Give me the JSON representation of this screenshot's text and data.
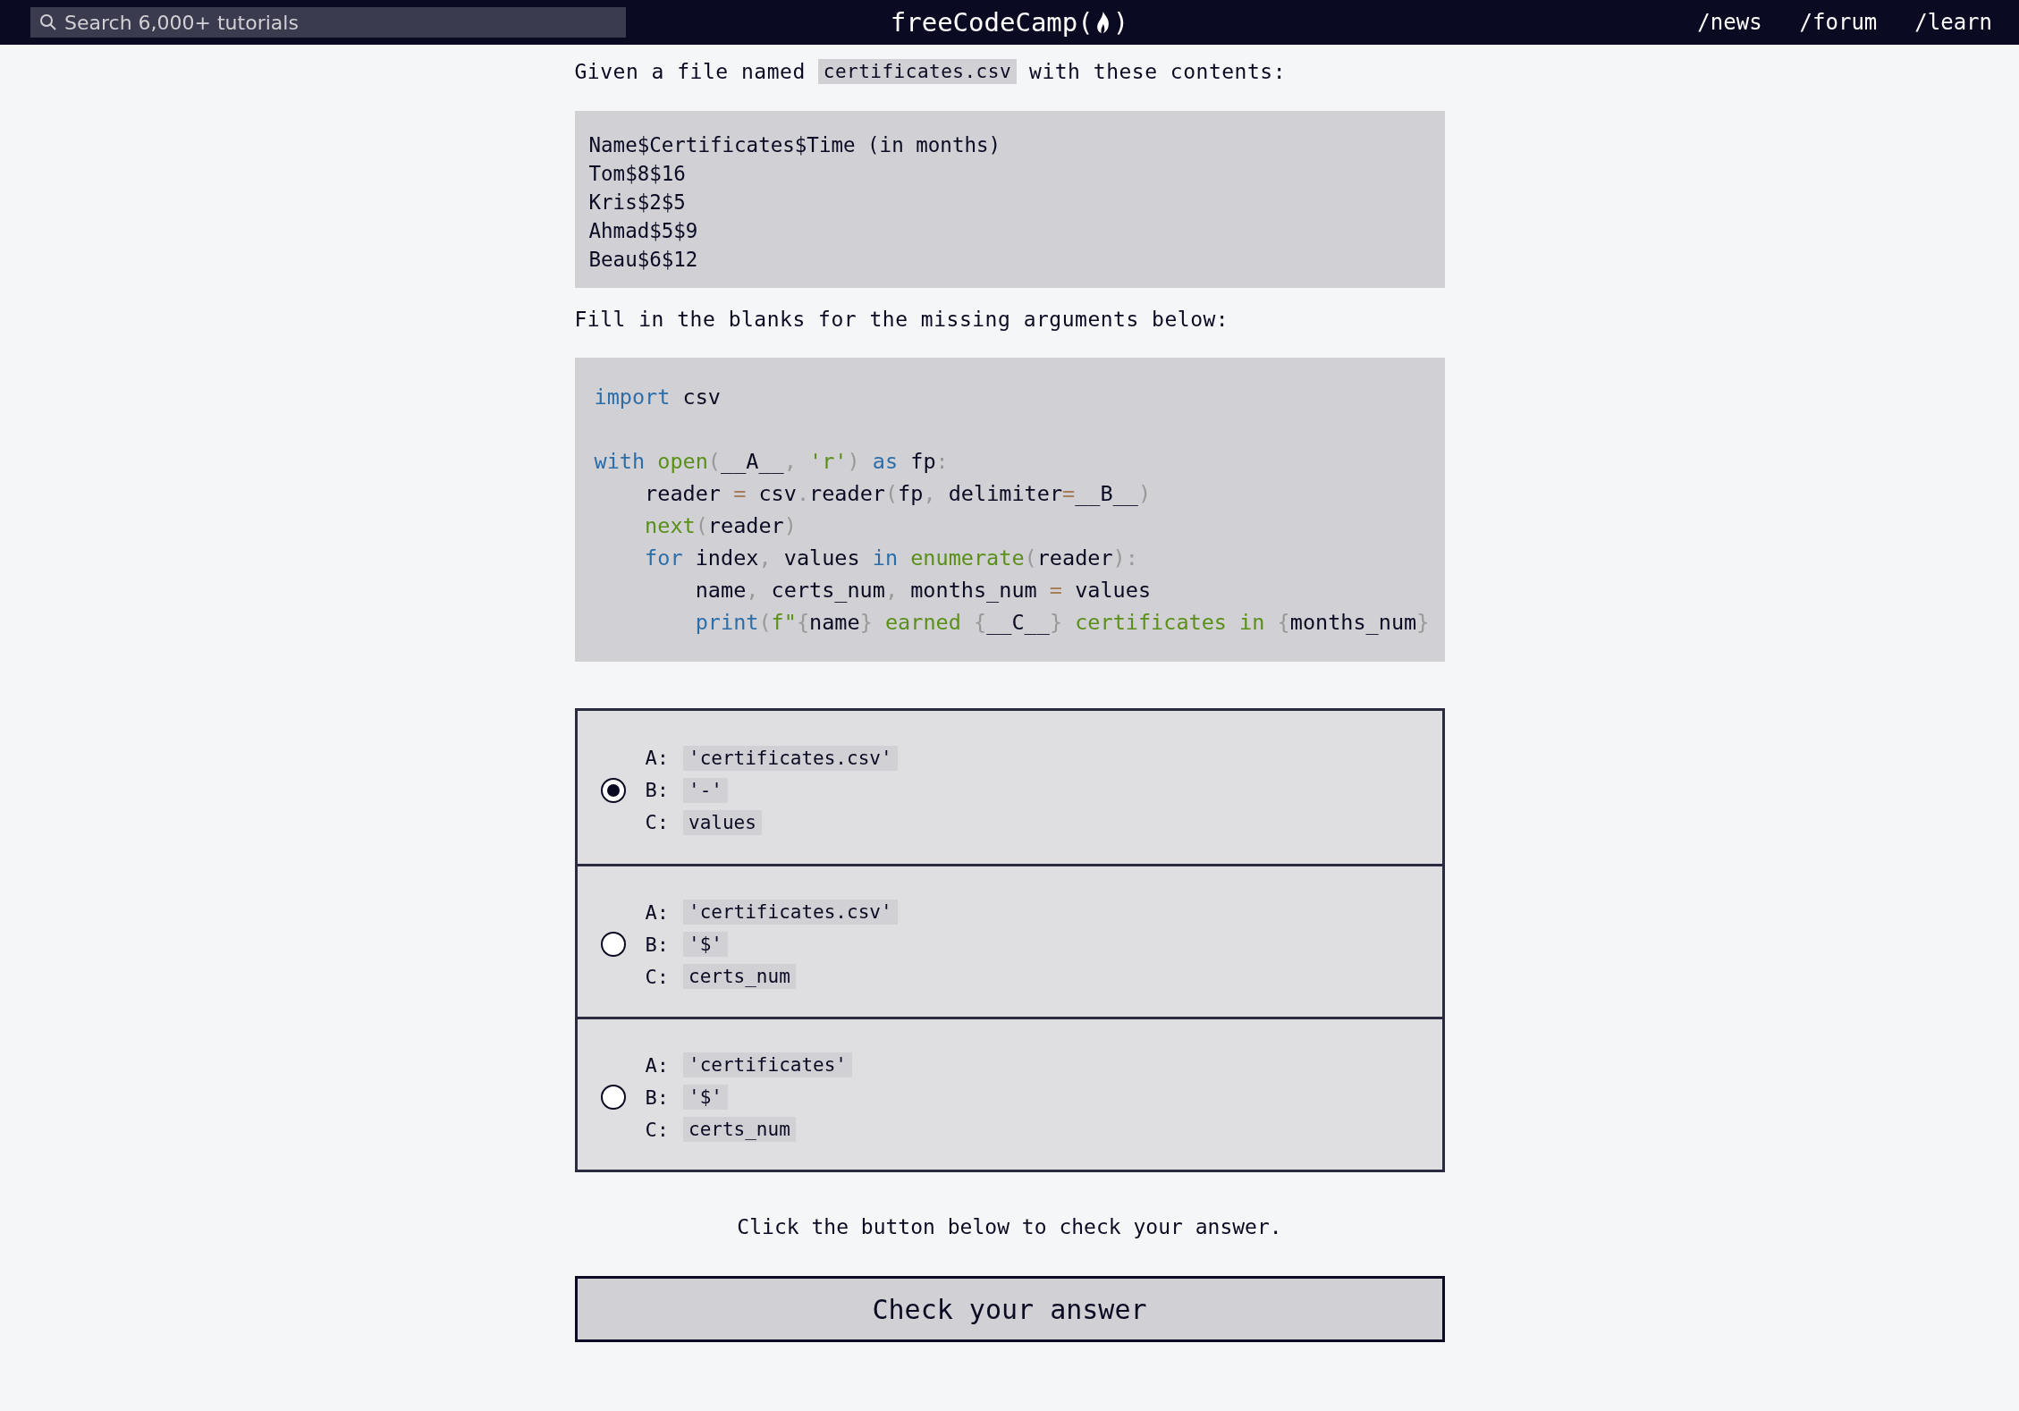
{
  "header": {
    "search": {
      "placeholder": "Search 6,000+ tutorials"
    },
    "logo": {
      "name": "freeCodeCamp(",
      "end": ")"
    },
    "nav": [
      "/news",
      "/forum",
      "/learn"
    ]
  },
  "intro": {
    "before": "Given a file named",
    "file": "certificates.csv",
    "after": "with these contents:"
  },
  "file_contents": [
    "Name$Certificates$Time (in months)",
    "Tom$8$16",
    "Kris$2$5",
    "Ahmad$5$9",
    "Beau$6$12"
  ],
  "prompt": "Fill in the blanks for the missing arguments below:",
  "code": {
    "blocks": [
      {
        "lines": [
          [
            {
              "text": "import",
              "kind": "keyword"
            },
            {
              "text": " csv",
              "kind": "plain"
            }
          ]
        ]
      },
      {
        "lines": [
          [
            {
              "text": "with",
              "kind": "keyword"
            },
            {
              "text": " open",
              "kind": "function"
            },
            {
              "text": "(",
              "kind": "punctuation"
            },
            {
              "text": "__A__",
              "kind": "plain"
            },
            {
              "text": ",",
              "kind": "punctuation"
            },
            {
              "text": " 'r'",
              "kind": "string"
            },
            {
              "text": ")",
              "kind": "punctuation"
            },
            {
              "text": " as",
              "kind": "keyword"
            },
            {
              "text": " fp",
              "kind": "plain"
            },
            {
              "text": ":",
              "kind": "punctuation"
            }
          ],
          [
            {
              "text": "    reader ",
              "kind": "plain"
            },
            {
              "text": "=",
              "kind": "operator"
            },
            {
              "text": " csv",
              "kind": "plain"
            },
            {
              "text": ".",
              "kind": "punctuation"
            },
            {
              "text": "reader",
              "kind": "plain"
            },
            {
              "text": "(",
              "kind": "punctuation"
            },
            {
              "text": "fp",
              "kind": "plain"
            },
            {
              "text": ",",
              "kind": "punctuation"
            },
            {
              "text": " delimiter",
              "kind": "plain"
            },
            {
              "text": "=",
              "kind": "operator"
            },
            {
              "text": "__B__",
              "kind": "plain"
            },
            {
              "text": ")",
              "kind": "punctuation"
            }
          ],
          [
            {
              "text": "    next",
              "kind": "function"
            },
            {
              "text": "(",
              "kind": "punctuation"
            },
            {
              "text": "reader",
              "kind": "plain"
            },
            {
              "text": ")",
              "kind": "punctuation"
            }
          ],
          [
            {
              "text": "    for",
              "kind": "keyword"
            },
            {
              "text": " index",
              "kind": "plain"
            },
            {
              "text": ",",
              "kind": "punctuation"
            },
            {
              "text": " values ",
              "kind": "plain"
            },
            {
              "text": "in",
              "kind": "keyword"
            },
            {
              "text": " enumerate",
              "kind": "function"
            },
            {
              "text": "(",
              "kind": "punctuation"
            },
            {
              "text": "reader",
              "kind": "plain"
            },
            {
              "text": ")",
              "kind": "punctuation"
            },
            {
              "text": ":",
              "kind": "punctuation"
            }
          ],
          [
            {
              "text": "        name",
              "kind": "plain"
            },
            {
              "text": ",",
              "kind": "punctuation"
            },
            {
              "text": " certs_num",
              "kind": "plain"
            },
            {
              "text": ",",
              "kind": "punctuation"
            },
            {
              "text": " months_num ",
              "kind": "plain"
            },
            {
              "text": "=",
              "kind": "operator"
            },
            {
              "text": " values",
              "kind": "plain"
            }
          ],
          [
            {
              "text": "        print",
              "kind": "keyword"
            },
            {
              "text": "(",
              "kind": "punctuation"
            },
            {
              "text": "f\"",
              "kind": "string"
            },
            {
              "text": "{",
              "kind": "punctuation"
            },
            {
              "text": "name",
              "kind": "plain"
            },
            {
              "text": "}",
              "kind": "punctuation"
            },
            {
              "text": " earned ",
              "kind": "string"
            },
            {
              "text": "{",
              "kind": "punctuation"
            },
            {
              "text": "__C__",
              "kind": "plain"
            },
            {
              "text": "}",
              "kind": "punctuation"
            },
            {
              "text": " certificates in ",
              "kind": "string"
            },
            {
              "text": "{",
              "kind": "punctuation"
            },
            {
              "text": "months_num",
              "kind": "plain"
            },
            {
              "text": "}",
              "kind": "punctuation"
            }
          ]
        ]
      }
    ]
  },
  "options": [
    {
      "selected": true,
      "answers": [
        {
          "label": "A:",
          "value": "'certificates.csv'"
        },
        {
          "label": "B:",
          "value": "'-'"
        },
        {
          "label": "C:",
          "value": "values"
        }
      ]
    },
    {
      "selected": false,
      "answers": [
        {
          "label": "A:",
          "value": "'certificates.csv'"
        },
        {
          "label": "B:",
          "value": "'$'"
        },
        {
          "label": "C:",
          "value": "certs_num"
        }
      ]
    },
    {
      "selected": false,
      "answers": [
        {
          "label": "A:",
          "value": "'certificates'"
        },
        {
          "label": "B:",
          "value": "'$'"
        },
        {
          "label": "C:",
          "value": "certs_num"
        }
      ]
    }
  ],
  "hint": "Click the button below to check your answer.",
  "check_button": "Check your answer"
}
